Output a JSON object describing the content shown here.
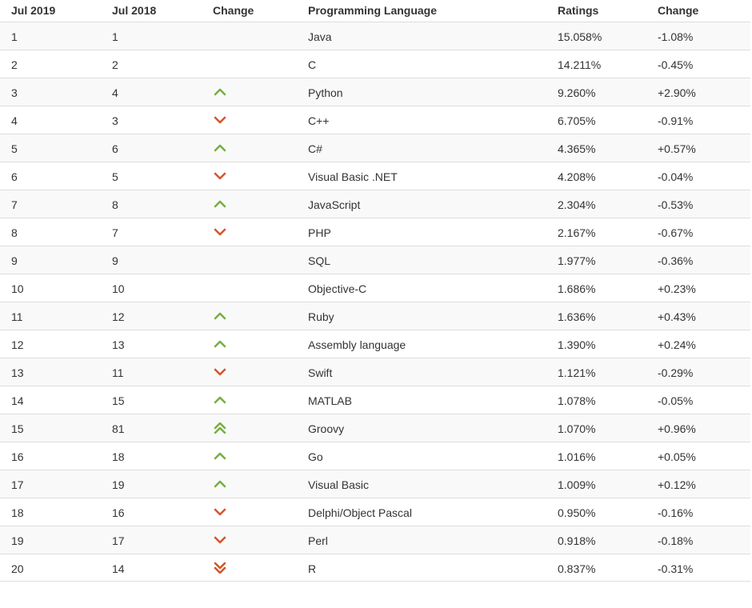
{
  "header": {
    "col_current": "Jul 2019",
    "col_previous": "Jul 2018",
    "col_change_icon": "Change",
    "col_language": "Programming Language",
    "col_ratings": "Ratings",
    "col_change": "Change"
  },
  "colors": {
    "up": "#76b043",
    "down": "#d4562a"
  },
  "rows": [
    {
      "rank": "1",
      "prev": "1",
      "trend": "none",
      "language": "Java",
      "rating": "15.058%",
      "change": "-1.08%"
    },
    {
      "rank": "2",
      "prev": "2",
      "trend": "none",
      "language": "C",
      "rating": "14.211%",
      "change": "-0.45%"
    },
    {
      "rank": "3",
      "prev": "4",
      "trend": "up",
      "language": "Python",
      "rating": "9.260%",
      "change": "+2.90%"
    },
    {
      "rank": "4",
      "prev": "3",
      "trend": "down",
      "language": "C++",
      "rating": "6.705%",
      "change": "-0.91%"
    },
    {
      "rank": "5",
      "prev": "6",
      "trend": "up",
      "language": "C#",
      "rating": "4.365%",
      "change": "+0.57%"
    },
    {
      "rank": "6",
      "prev": "5",
      "trend": "down",
      "language": "Visual Basic .NET",
      "rating": "4.208%",
      "change": "-0.04%"
    },
    {
      "rank": "7",
      "prev": "8",
      "trend": "up",
      "language": "JavaScript",
      "rating": "2.304%",
      "change": "-0.53%"
    },
    {
      "rank": "8",
      "prev": "7",
      "trend": "down",
      "language": "PHP",
      "rating": "2.167%",
      "change": "-0.67%"
    },
    {
      "rank": "9",
      "prev": "9",
      "trend": "none",
      "language": "SQL",
      "rating": "1.977%",
      "change": "-0.36%"
    },
    {
      "rank": "10",
      "prev": "10",
      "trend": "none",
      "language": "Objective-C",
      "rating": "1.686%",
      "change": "+0.23%"
    },
    {
      "rank": "11",
      "prev": "12",
      "trend": "up",
      "language": "Ruby",
      "rating": "1.636%",
      "change": "+0.43%"
    },
    {
      "rank": "12",
      "prev": "13",
      "trend": "up",
      "language": "Assembly language",
      "rating": "1.390%",
      "change": "+0.24%"
    },
    {
      "rank": "13",
      "prev": "11",
      "trend": "down",
      "language": "Swift",
      "rating": "1.121%",
      "change": "-0.29%"
    },
    {
      "rank": "14",
      "prev": "15",
      "trend": "up",
      "language": "MATLAB",
      "rating": "1.078%",
      "change": "-0.05%"
    },
    {
      "rank": "15",
      "prev": "81",
      "trend": "double-up",
      "language": "Groovy",
      "rating": "1.070%",
      "change": "+0.96%"
    },
    {
      "rank": "16",
      "prev": "18",
      "trend": "up",
      "language": "Go",
      "rating": "1.016%",
      "change": "+0.05%"
    },
    {
      "rank": "17",
      "prev": "19",
      "trend": "up",
      "language": "Visual Basic",
      "rating": "1.009%",
      "change": "+0.12%"
    },
    {
      "rank": "18",
      "prev": "16",
      "trend": "down",
      "language": "Delphi/Object Pascal",
      "rating": "0.950%",
      "change": "-0.16%"
    },
    {
      "rank": "19",
      "prev": "17",
      "trend": "down",
      "language": "Perl",
      "rating": "0.918%",
      "change": "-0.18%"
    },
    {
      "rank": "20",
      "prev": "14",
      "trend": "double-down",
      "language": "R",
      "rating": "0.837%",
      "change": "-0.31%"
    }
  ]
}
